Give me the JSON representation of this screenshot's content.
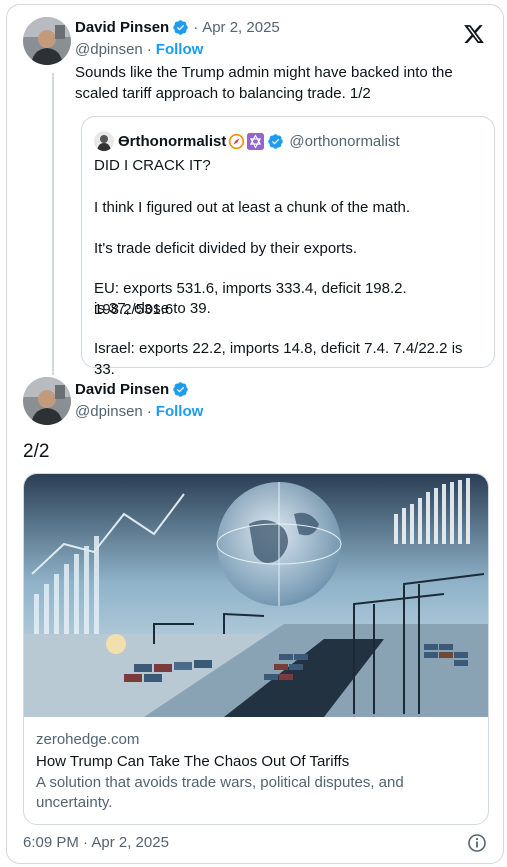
{
  "tweet1": {
    "author_name": "David Pinsen",
    "separator": "·",
    "date": "Apr 2, 2025",
    "handle": "@dpinsen",
    "follow_label": "Follow",
    "text_line1": "Sounds like the Trump admin might have backed into the",
    "text_line2": "scaled tariff approach to balancing trade. 1/2"
  },
  "quote": {
    "author_name": "ϴrthonormalist",
    "handle": "@orthonormalist",
    "lines": [
      "DID I CRACK IT?",
      "I think I figured out at least a chunk of the math.",
      "It's trade deficit divided by their exports.",
      "EU: exports 531.6, imports 333.4, deficit 198.2. 198.2/531.6",
      "is 37, close to 39.",
      "Israel: exports 22.2, imports 14.8, deficit 7.4. 7.4/22.2 is 33."
    ]
  },
  "tweet2": {
    "author_name": "David Pinsen",
    "handle": "@dpinsen",
    "separator": "·",
    "follow_label": "Follow",
    "text": "2/2"
  },
  "link_card": {
    "domain": "zerohedge.com",
    "title": "How Trump Can Take The Chaos Out Of Tariffs",
    "description_line1": "A solution that avoids trade wars, political disputes, and",
    "description_line2": "uncertainty."
  },
  "footer": {
    "timestamp": "6:09 PM · Apr 2, 2025"
  },
  "colors": {
    "accent": "#1d9bf0",
    "muted": "#536471",
    "border": "#cfd9de"
  },
  "icons": [
    "x-logo-icon",
    "verified-badge-icon",
    "compass-emoji-icon",
    "star-of-david-emoji-icon",
    "info-icon"
  ]
}
